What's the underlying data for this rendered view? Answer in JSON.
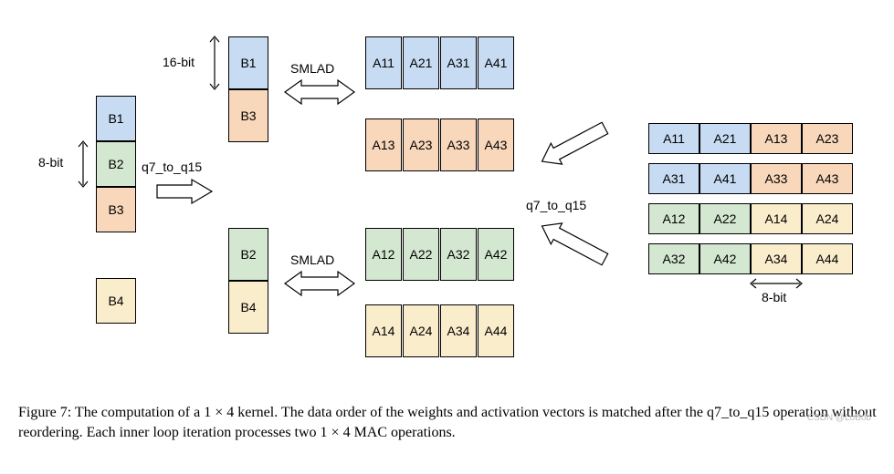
{
  "labels": {
    "bit8": "8-bit",
    "bit16": "16-bit",
    "bit8_right": "8-bit",
    "q7": "q7_to_q15",
    "q7_right": "q7_to_q15",
    "smlad1": "SMLAD",
    "smlad2": "SMLAD"
  },
  "colB8": {
    "b1": "B1",
    "b2": "B2",
    "b3": "B3",
    "b4": "B4"
  },
  "colBtop": {
    "b1": "B1",
    "b3": "B3"
  },
  "colBbot": {
    "b2": "B2",
    "b4": "B4"
  },
  "gridTop": {
    "r1": {
      "c1": "A11",
      "c2": "A21",
      "c3": "A31",
      "c4": "A41"
    },
    "r2": {
      "c1": "A13",
      "c2": "A23",
      "c3": "A33",
      "c4": "A43"
    }
  },
  "gridBot": {
    "r1": {
      "c1": "A12",
      "c2": "A22",
      "c3": "A32",
      "c4": "A42"
    },
    "r2": {
      "c1": "A14",
      "c2": "A24",
      "c3": "A34",
      "c4": "A44"
    }
  },
  "rightRows": {
    "r1": {
      "c1": "A11",
      "c2": "A21",
      "c3": "A13",
      "c4": "A23"
    },
    "r2": {
      "c1": "A31",
      "c2": "A41",
      "c3": "A33",
      "c4": "A43"
    },
    "r3": {
      "c1": "A12",
      "c2": "A22",
      "c3": "A14",
      "c4": "A24"
    },
    "r4": {
      "c1": "A32",
      "c2": "A42",
      "c3": "A34",
      "c4": "A44"
    }
  },
  "caption": "Figure 7: The computation of a 1 × 4 kernel. The data order of the weights and activation vectors is matched after the q7_to_q15 operation without reordering. Each inner loop iteration processes two 1 × 4 MAC operations.",
  "watermark": "CSDN @LoBob"
}
